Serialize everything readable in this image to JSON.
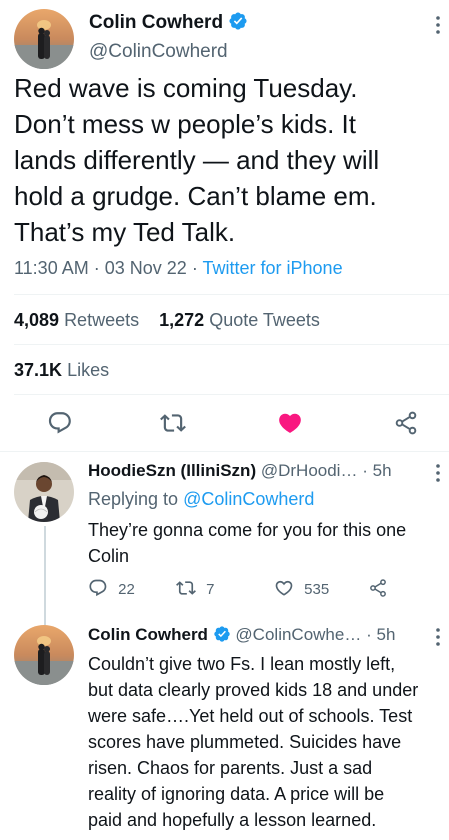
{
  "main_tweet": {
    "author_name": "Colin Cowherd",
    "author_handle": "@ColinCowherd",
    "text_lines": [
      "Red wave is coming Tuesday.",
      "Don’t mess w people’s kids. It",
      "lands differently — and they will",
      "hold a grudge. Can’t blame em.",
      "That’s my Ted Talk."
    ],
    "time": "11:30 AM",
    "date": "03 Nov 22",
    "source": "Twitter for iPhone",
    "retweets_count": "4,089",
    "retweets_label": "Retweets",
    "quotes_count": "1,272",
    "quotes_label": "Quote Tweets",
    "likes_count": "37.1K",
    "likes_label": "Likes"
  },
  "reply_1": {
    "author_name": "HoodieSzn (IlliniSzn)",
    "author_handle": "@DrHoodi…",
    "time_ago": "5h",
    "replying_prefix": "Replying to",
    "replying_to": "@ColinCowherd",
    "text_lines": [
      "They’re gonna come for you for this one",
      "Colin"
    ],
    "reply_count": "22",
    "retweet_count": "7",
    "like_count": "535"
  },
  "reply_2": {
    "author_name": "Colin Cowherd",
    "author_handle": "@ColinCowhe…",
    "time_ago": "5h",
    "text_lines": [
      "Couldn’t give two Fs. I lean mostly left,",
      "but data clearly proved kids 18 and under",
      "were safe….Yet held out of schools. Test",
      "scores have plummeted. Suicides have",
      "risen. Chaos for parents. Just a sad",
      "reality of ignoring data. A price will be",
      "paid and hopefully a lesson learned."
    ]
  },
  "separator_dot": "·",
  "colors": {
    "accent": "#1d9bf0",
    "like_pink": "#f91880",
    "text": "#0f1419",
    "secondary": "#536471",
    "divider": "#eff3f4"
  },
  "icons": [
    "verified-badge-icon",
    "more-options-icon",
    "reply-icon",
    "retweet-icon",
    "like-icon",
    "share-icon"
  ]
}
